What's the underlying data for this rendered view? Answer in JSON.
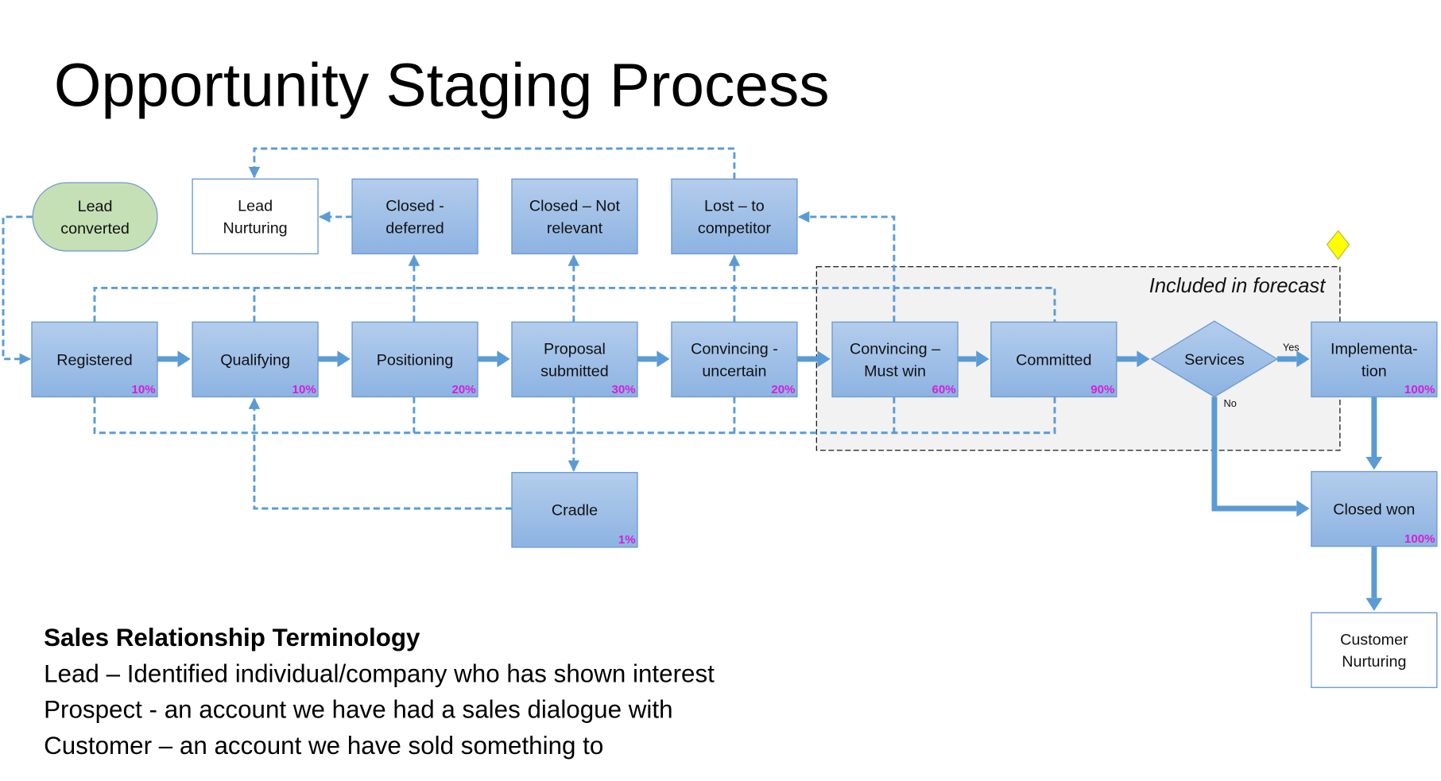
{
  "title": "Opportunity Staging Process",
  "colors": {
    "stage_fill_top": "#b0cbeb",
    "stage_fill_bottom": "#8fb4e3",
    "stage_border": "#6d9cd2",
    "connector": "#5b9bd5",
    "percent": "#d61fd6",
    "lead_fill": "#c5e0b4",
    "forecast_fill": "#f2f2f2",
    "marker": "#ffff00"
  },
  "nodes": {
    "lead_converted": {
      "lines": [
        "Lead",
        "converted"
      ]
    },
    "lead_nurturing": {
      "lines": [
        "Lead",
        "Nurturing"
      ]
    },
    "closed_deferred": {
      "lines": [
        "Closed -",
        "deferred"
      ]
    },
    "closed_not_relevant": {
      "lines": [
        "Closed – Not",
        "relevant"
      ]
    },
    "lost_competitor": {
      "lines": [
        "Lost – to",
        "competitor"
      ]
    },
    "registered": {
      "lines": [
        "Registered"
      ],
      "percent": "10%"
    },
    "qualifying": {
      "lines": [
        "Qualifying"
      ],
      "percent": "10%"
    },
    "positioning": {
      "lines": [
        "Positioning"
      ],
      "percent": "20%"
    },
    "proposal": {
      "lines": [
        "Proposal",
        "submitted"
      ],
      "percent": "30%"
    },
    "conv_uncertain": {
      "lines": [
        "Convincing -",
        "uncertain"
      ],
      "percent": "20%"
    },
    "conv_mustwin": {
      "lines": [
        "Convincing –",
        "Must win"
      ],
      "percent": "60%"
    },
    "committed": {
      "lines": [
        "Committed"
      ],
      "percent": "90%"
    },
    "services": {
      "lines": [
        "Services"
      ]
    },
    "implementation": {
      "lines": [
        "Implementa-",
        "tion"
      ],
      "percent": "100%"
    },
    "cradle": {
      "lines": [
        "Cradle"
      ],
      "percent": "1%"
    },
    "closed_won": {
      "lines": [
        "Closed won"
      ],
      "percent": "100%"
    },
    "customer_nurturing": {
      "lines": [
        "Customer",
        "Nurturing"
      ]
    }
  },
  "decision_labels": {
    "yes": "Yes",
    "no": "No"
  },
  "forecast_label": "Included in forecast",
  "terminology": {
    "heading": "Sales Relationship Terminology",
    "lines": [
      "Lead – Identified individual/company who has shown interest",
      "Prospect - an account we have had a sales dialogue with",
      "Customer – an account we have sold something to"
    ]
  }
}
